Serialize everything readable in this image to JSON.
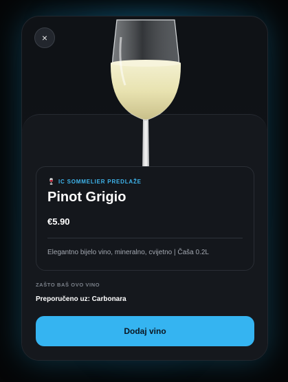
{
  "modal": {
    "close_icon": "×",
    "badge": {
      "icon": "wine-glass-icon",
      "icon_glyph": "🍷",
      "text": "IC SOMMELIER PREDLAŽE"
    },
    "wine": {
      "name": "Pinot Grigio",
      "price": "€5.90",
      "description": "Elegantno bijelo vino, mineralno, cvijetno | Čaša 0.2L"
    },
    "why": {
      "label": "ZAŠTO BAŠ OVO VINO",
      "text": "Preporučeno uz: Carbonara"
    },
    "add_button": "Dodaj vino"
  },
  "colors": {
    "accent": "#35b4f1",
    "badge_text": "#3fb6ee",
    "glow": "#146e96"
  }
}
